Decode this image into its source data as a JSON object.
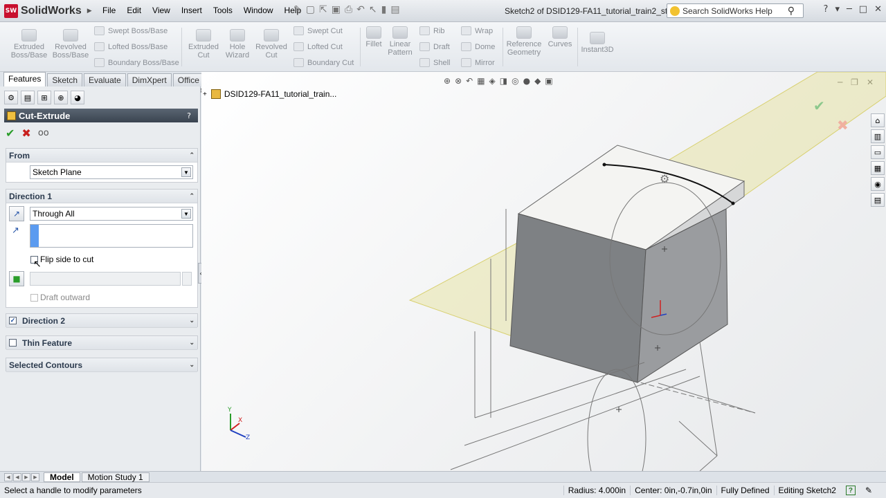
{
  "app": {
    "logo_text": "SW",
    "name": "SolidWorks",
    "doc_title": "Sketch2 of DSID129-FA11_tutorial_train2_st..."
  },
  "menu": [
    "File",
    "Edit",
    "View",
    "Insert",
    "Tools",
    "Window",
    "Help"
  ],
  "search": {
    "placeholder": "Search SolidWorks Help"
  },
  "command_manager": {
    "big": [
      {
        "label1": "Extruded",
        "label2": "Boss/Base"
      },
      {
        "label1": "Revolved",
        "label2": "Boss/Base"
      },
      {
        "label1": "Extruded",
        "label2": "Cut"
      },
      {
        "label1": "Hole",
        "label2": "Wizard"
      },
      {
        "label1": "Revolved",
        "label2": "Cut"
      },
      {
        "label1": "Fillet",
        "label2": ""
      },
      {
        "label1": "Linear",
        "label2": "Pattern"
      },
      {
        "label1": "Reference",
        "label2": "Geometry"
      },
      {
        "label1": "Curves",
        "label2": ""
      },
      {
        "label1": "Instant3D",
        "label2": ""
      }
    ],
    "rows": [
      "Swept Boss/Base",
      "Lofted Boss/Base",
      "Boundary Boss/Base",
      "Swept Cut",
      "Lofted Cut",
      "Boundary Cut",
      "Rib",
      "Draft",
      "Shell",
      "Wrap",
      "Dome",
      "Mirror"
    ]
  },
  "tabs": [
    "Features",
    "Sketch",
    "Evaluate",
    "DimXpert",
    "Office Products"
  ],
  "panel": {
    "title": "Cut-Extrude",
    "help": "?",
    "from": {
      "header": "From",
      "value": "Sketch Plane"
    },
    "direction1": {
      "header": "Direction 1",
      "end_condition": "Through All",
      "flip_label": "Flip side to cut",
      "draft_label": "Draft outward"
    },
    "direction2": {
      "header": "Direction 2"
    },
    "thin": {
      "header": "Thin Feature"
    },
    "contours": {
      "header": "Selected Contours"
    }
  },
  "viewport": {
    "tree_root": "DSID129-FA11_tutorial_train...",
    "axis_x": "X",
    "axis_y": "Y",
    "axis_z": "Z"
  },
  "bottom_tabs": [
    "Model",
    "Motion Study 1"
  ],
  "status": {
    "message": "Select a handle to modify parameters",
    "radius": "Radius: 4.000in",
    "center": "Center: 0in,-0.7in,0in",
    "state": "Fully Defined",
    "editing": "Editing Sketch2",
    "help": "?"
  },
  "colors": {
    "accent": "#3a4450",
    "preview": "#e8e4b0",
    "model": "#8a8d90"
  }
}
